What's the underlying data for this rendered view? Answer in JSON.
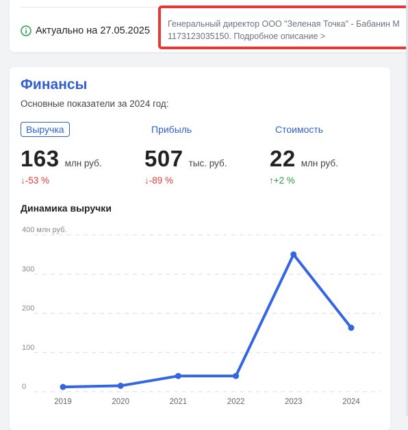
{
  "info": {
    "actual_text": "Актуально на 27.05.2025",
    "highlight_line1": "Генеральный директор ООО \"Зеленая Точка\" - Бабанин М",
    "highlight_line2": "1173123035150. Подробное описание >"
  },
  "finance": {
    "title": "Финансы",
    "subtitle": "Основные показатели за 2024 год:",
    "tabs": [
      {
        "label": "Выручка",
        "active": true
      },
      {
        "label": "Прибыль",
        "active": false
      },
      {
        "label": "Стоимость",
        "active": false
      }
    ],
    "metrics": [
      {
        "value": "163",
        "unit": "млн руб.",
        "delta": "↓-53 %",
        "trend": "down"
      },
      {
        "value": "507",
        "unit": "тыс. руб.",
        "delta": "↓-89 %",
        "trend": "down"
      },
      {
        "value": "22",
        "unit": "млн руб.",
        "delta": "↑+2 %",
        "trend": "up"
      }
    ],
    "chart_title": "Динамика выручки"
  },
  "colors": {
    "accent": "#2f5fd0",
    "line": "#3366e0",
    "down": "#e53935",
    "up": "#2e9d4a",
    "highlight_border": "#e53935"
  },
  "chart_data": {
    "type": "line",
    "title": "Динамика выручки",
    "x": [
      "2019",
      "2020",
      "2021",
      "2022",
      "2023",
      "2024"
    ],
    "series": [
      {
        "values": [
          12,
          15,
          40,
          40,
          350,
          163
        ]
      }
    ],
    "yticks": [
      "0",
      "100",
      "200",
      "300",
      "400 млн руб."
    ],
    "ylim": [
      0,
      400
    ],
    "grid": true,
    "grid_style": "dashed"
  }
}
